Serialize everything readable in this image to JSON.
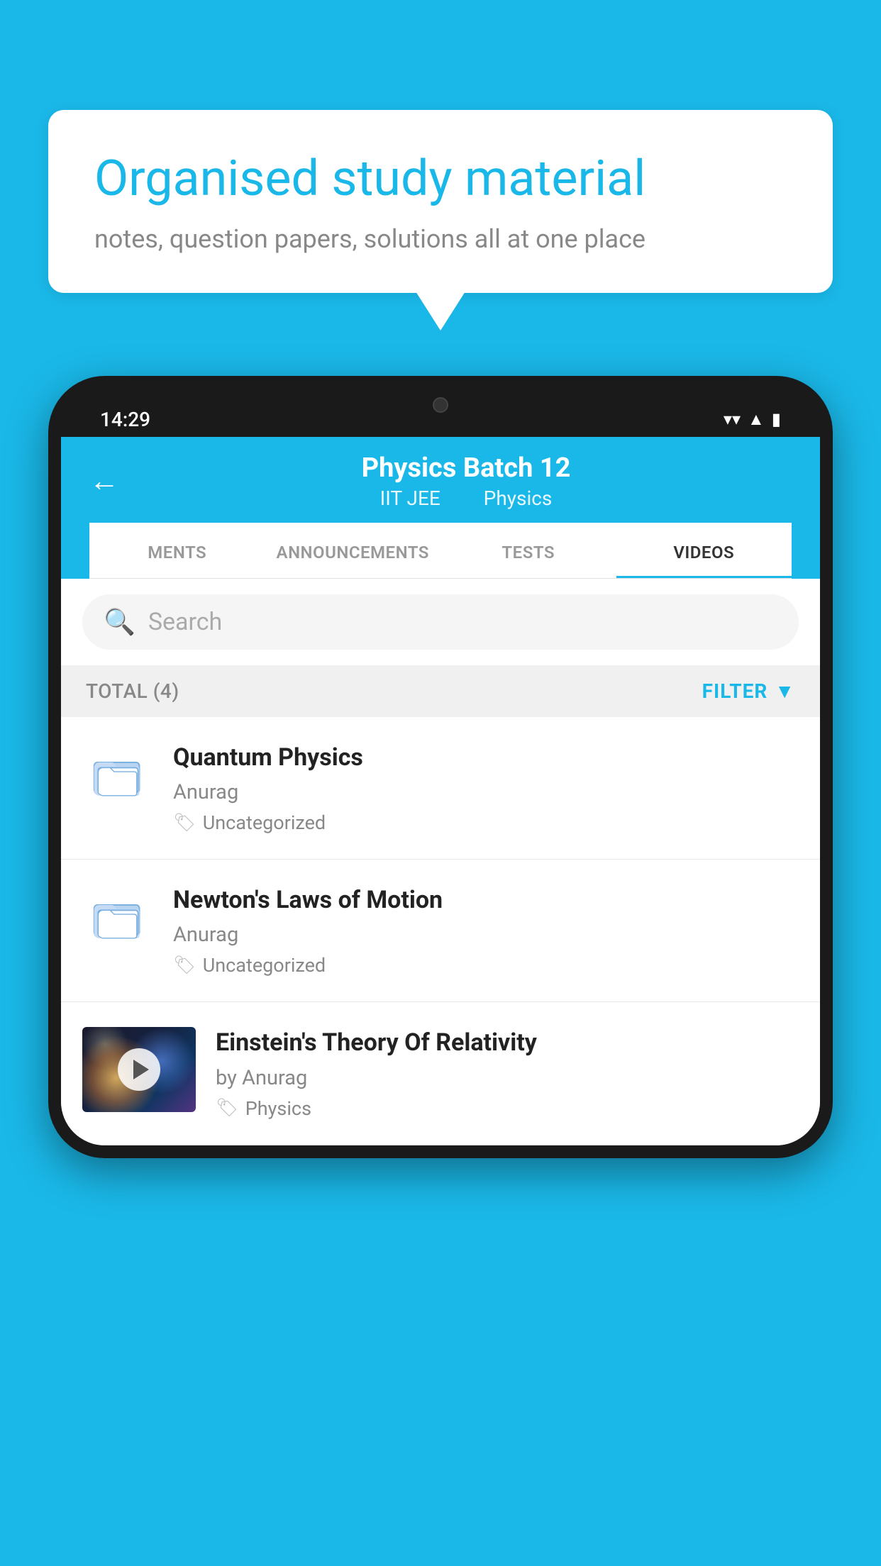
{
  "background_color": "#1ab8e8",
  "speech_bubble": {
    "title": "Organised study material",
    "subtitle": "notes, question papers, solutions all at one place"
  },
  "phone": {
    "status_bar": {
      "time": "14:29"
    },
    "header": {
      "back_label": "←",
      "title": "Physics Batch 12",
      "subtitle_part1": "IIT JEE",
      "subtitle_part2": "Physics"
    },
    "tabs": [
      {
        "label": "MENTS",
        "active": false
      },
      {
        "label": "ANNOUNCEMENTS",
        "active": false
      },
      {
        "label": "TESTS",
        "active": false
      },
      {
        "label": "VIDEOS",
        "active": true
      }
    ],
    "search": {
      "placeholder": "Search"
    },
    "filter_bar": {
      "total_label": "TOTAL (4)",
      "filter_label": "FILTER"
    },
    "videos": [
      {
        "id": "v1",
        "title": "Quantum Physics",
        "author": "Anurag",
        "tag": "Uncategorized",
        "has_thumbnail": false
      },
      {
        "id": "v2",
        "title": "Newton's Laws of Motion",
        "author": "Anurag",
        "tag": "Uncategorized",
        "has_thumbnail": false
      },
      {
        "id": "v3",
        "title": "Einstein's Theory Of Relativity",
        "author": "by Anurag",
        "tag": "Physics",
        "has_thumbnail": true
      }
    ]
  }
}
